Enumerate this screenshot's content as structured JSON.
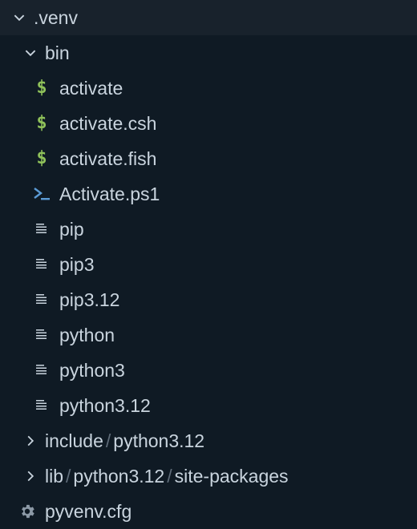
{
  "tree": {
    "root": {
      "label": ".venv",
      "expanded": true
    },
    "bin": {
      "label": "bin",
      "expanded": true
    },
    "bin_files": [
      {
        "label": "activate",
        "icon": "shell-dollar-icon"
      },
      {
        "label": "activate.csh",
        "icon": "shell-dollar-icon"
      },
      {
        "label": "activate.fish",
        "icon": "shell-dollar-icon"
      },
      {
        "label": "Activate.ps1",
        "icon": "powershell-icon"
      },
      {
        "label": "pip",
        "icon": "text-file-icon"
      },
      {
        "label": "pip3",
        "icon": "text-file-icon"
      },
      {
        "label": "pip3.12",
        "icon": "text-file-icon"
      },
      {
        "label": "python",
        "icon": "text-file-icon"
      },
      {
        "label": "python3",
        "icon": "text-file-icon"
      },
      {
        "label": "python3.12",
        "icon": "text-file-icon"
      }
    ],
    "include": {
      "seg1": "include",
      "seg2": "python3.12",
      "expanded": false
    },
    "lib": {
      "seg1": "lib",
      "seg2": "python3.12",
      "seg3": "site-packages",
      "expanded": false
    },
    "pyvenv": {
      "label": "pyvenv.cfg",
      "icon": "gear-icon"
    },
    "separator": "/"
  },
  "colors": {
    "background": "#0f1a24",
    "text": "#c9d4de",
    "shell_icon": "#8fc15a",
    "powershell_icon": "#5b9bd5",
    "separator": "#5e6b78"
  }
}
